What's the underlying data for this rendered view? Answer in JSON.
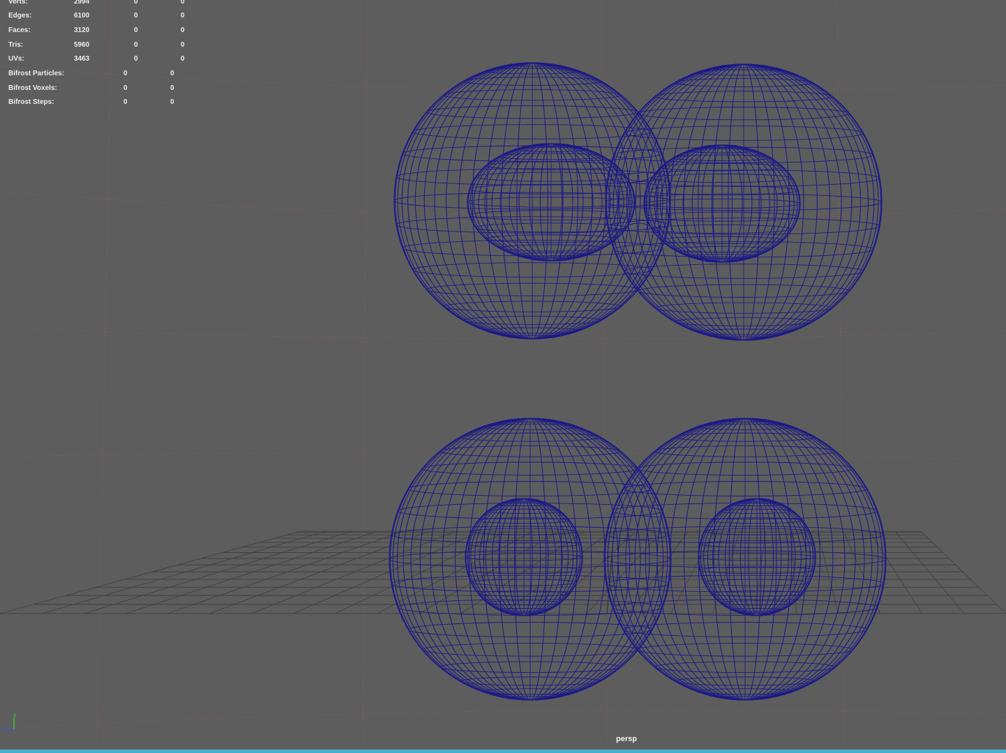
{
  "viewport": {
    "camera": "persp",
    "background_color": "#5d5d5d",
    "wire_color": "#1c1a88",
    "grid_color": "#3d3d3d",
    "guide_color": "#9a5a54",
    "status_strip_color": "#45b0cc"
  },
  "heads_up_display": {
    "rows": [
      {
        "label": "Verts:",
        "values": [
          "2994",
          "0",
          "0"
        ]
      },
      {
        "label": "Edges:",
        "values": [
          "6100",
          "0",
          "0"
        ]
      },
      {
        "label": "Faces:",
        "values": [
          "3120",
          "0",
          "0"
        ]
      },
      {
        "label": "Tris:",
        "values": [
          "5960",
          "0",
          "0"
        ]
      },
      {
        "label": "UVs:",
        "values": [
          "3463",
          "0",
          "0"
        ]
      },
      {
        "label": "Bifrost Particles:",
        "values": [
          "0",
          "0"
        ]
      },
      {
        "label": "Bifrost Voxels:",
        "values": [
          "0",
          "0"
        ]
      },
      {
        "label": "Bifrost Steps:",
        "values": [
          "0",
          "0"
        ]
      }
    ]
  },
  "axis_indicator": {
    "x_label": "x",
    "y_label": "y",
    "z_label": "z",
    "x_color": "#d23a3a",
    "y_color": "#3ec43e",
    "z_color": "#3a5ad2",
    "icon": "axis-gizmo-icon"
  },
  "objects": [
    {
      "name": "wireframe-outer-spheres-top",
      "icon": "mesh-icon"
    },
    {
      "name": "wireframe-inner-dumbbell-top",
      "icon": "mesh-icon"
    },
    {
      "name": "wireframe-outer-spheres-bottom",
      "icon": "mesh-icon"
    },
    {
      "name": "wireframe-inner-spheres-bottom",
      "icon": "mesh-icon"
    }
  ]
}
